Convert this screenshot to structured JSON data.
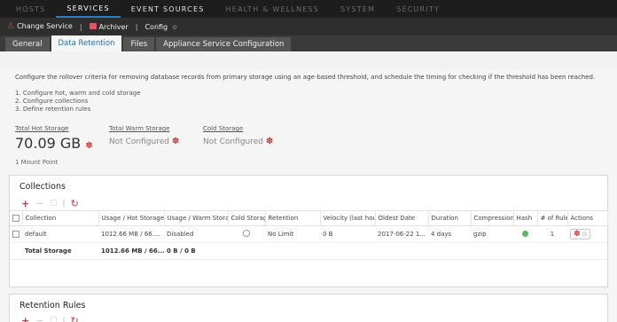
{
  "top_nav": [
    "HOSTS",
    "SERVICES",
    "EVENT SOURCES",
    "HEALTH & WELLNESS",
    "SYSTEM",
    "SECURITY"
  ],
  "toolbar": {
    "change_service": "Change Service",
    "archiver": "Archiver",
    "config": "Config"
  },
  "tabs": [
    "General",
    "Data Retention",
    "Files",
    "Appliance Service Configuration"
  ],
  "description": "Configure the rollover criteria for removing database records from primary storage using an age-based threshold, and schedule the timing for checking if the threshold has been reached.",
  "steps": [
    "1. Configure hot, warm and cold storage",
    "2. Configure collections",
    "3. Define retention rules"
  ],
  "storage": {
    "hot_label": "Total Hot Storage",
    "hot_value": "70.09 GB",
    "mount": "1 Mount Point",
    "warm_label": "Total Warm Storage",
    "warm_value": "Not Configured",
    "cold_label": "Cold Storage",
    "cold_value": "Not Configured"
  },
  "collections": {
    "title": "Collections",
    "columns": [
      "Collection",
      "Usage / Hot Storage",
      "Usage / Warm Storag",
      "Cold Storag",
      "Retention",
      "Velocity (last hou",
      "Oldest Date",
      "Duration",
      "Compression",
      "Hash",
      "# of Rules",
      "Actions"
    ],
    "row": {
      "collection": "default",
      "usage_hot": "1012.66 MB / 66....",
      "usage_warm": "Disabled",
      "retention": "No Limit",
      "velocity": "0 B",
      "oldest": "2017-06-22 1...",
      "duration": "4 days",
      "compression": "gzip",
      "rules": "1"
    },
    "total": {
      "label": "Total Storage",
      "hot": "1012.66 MB / 66....",
      "warm": "0 B / 0 B"
    }
  },
  "retention_rules": {
    "title": "Retention Rules"
  },
  "colors": {
    "accent": "#2a7fc4",
    "brand_red": "#d63a3a",
    "hash_ok": "#5cb85c"
  }
}
